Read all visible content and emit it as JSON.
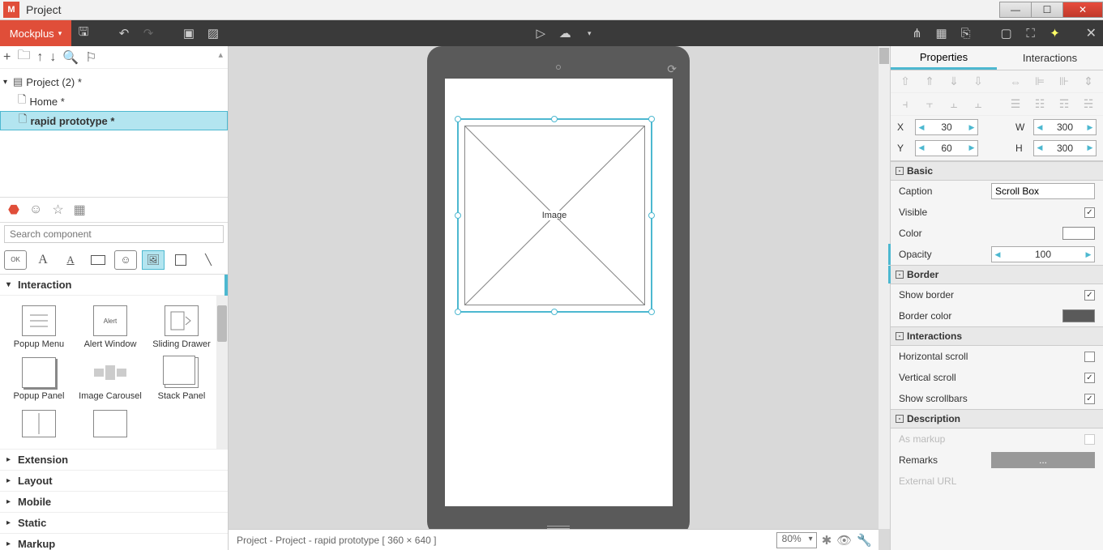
{
  "titlebar": {
    "app_title": "Project"
  },
  "toolbar": {
    "brand": "Mockplus"
  },
  "tree": {
    "root": "Project (2)  *",
    "items": [
      "Home  *",
      "rapid prototype  *"
    ]
  },
  "search": {
    "placeholder": "Search component"
  },
  "shape_row": {
    "ok": "OK",
    "a": "A"
  },
  "sections": {
    "interaction": "Interaction",
    "extension": "Extension",
    "layout": "Layout",
    "mobile": "Mobile",
    "static": "Static",
    "markup": "Markup"
  },
  "components": {
    "popup_menu": "Popup Menu",
    "alert_window": "Alert Window",
    "alert_thumb": "Alert",
    "sliding_drawer": "Sliding Drawer",
    "popup_panel": "Popup Panel",
    "image_carousel": "Image Carousel",
    "stack_panel": "Stack Panel"
  },
  "canvas": {
    "image_label": "Image"
  },
  "statusbar": {
    "path": "Project - Project - rapid prototype [ 360 × 640 ]",
    "zoom": "80%"
  },
  "right": {
    "tab_properties": "Properties",
    "tab_interactions": "Interactions",
    "x": "X",
    "x_val": "30",
    "y": "Y",
    "y_val": "60",
    "w": "W",
    "w_val": "300",
    "h": "H",
    "h_val": "300",
    "basic": "Basic",
    "caption": "Caption",
    "caption_val": "Scroll Box",
    "visible": "Visible",
    "color": "Color",
    "opacity": "Opacity",
    "opacity_val": "100",
    "border": "Border",
    "show_border": "Show border",
    "border_color": "Border color",
    "interactions": "Interactions",
    "h_scroll": "Horizontal scroll",
    "v_scroll": "Vertical scroll",
    "show_sb": "Show scrollbars",
    "description": "Description",
    "as_markup": "As markup",
    "remarks": "Remarks",
    "remarks_btn": "...",
    "external_url": "External URL"
  }
}
